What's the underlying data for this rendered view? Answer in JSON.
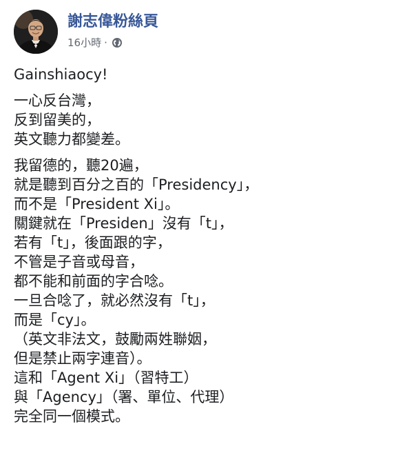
{
  "post": {
    "page_name": "謝志偉粉絲頁",
    "timestamp": "16小時",
    "separator": "·",
    "privacy_icon": "globe-icon",
    "paragraphs": [
      [
        "Gainshiaocy!"
      ],
      [
        "一心反台灣，",
        "反到留美的，",
        "英文聽力都變差。"
      ],
      [
        "我留德的，聽20遍，",
        "就是聽到百分之百的「Presidency」，",
        "而不是「President Xi」。",
        "關鍵就在「Presiden」沒有「t」，",
        "若有「t」，後面跟的字，",
        "不管是子音或母音，",
        "都不能和前面的字合唸。",
        "一旦合唸了，就必然沒有「t」，",
        "而是「cy」。",
        "（英文非法文，鼓勵兩姓聯姻，",
        "但是禁止兩字連音）。",
        "這和「Agent Xi」（習特工）",
        "與「Agency」（署、單位、代理）",
        "完全同一個模式。"
      ]
    ]
  },
  "colors": {
    "page_name": "#385898",
    "meta_text": "#616770",
    "body_text": "#1c1e21"
  }
}
